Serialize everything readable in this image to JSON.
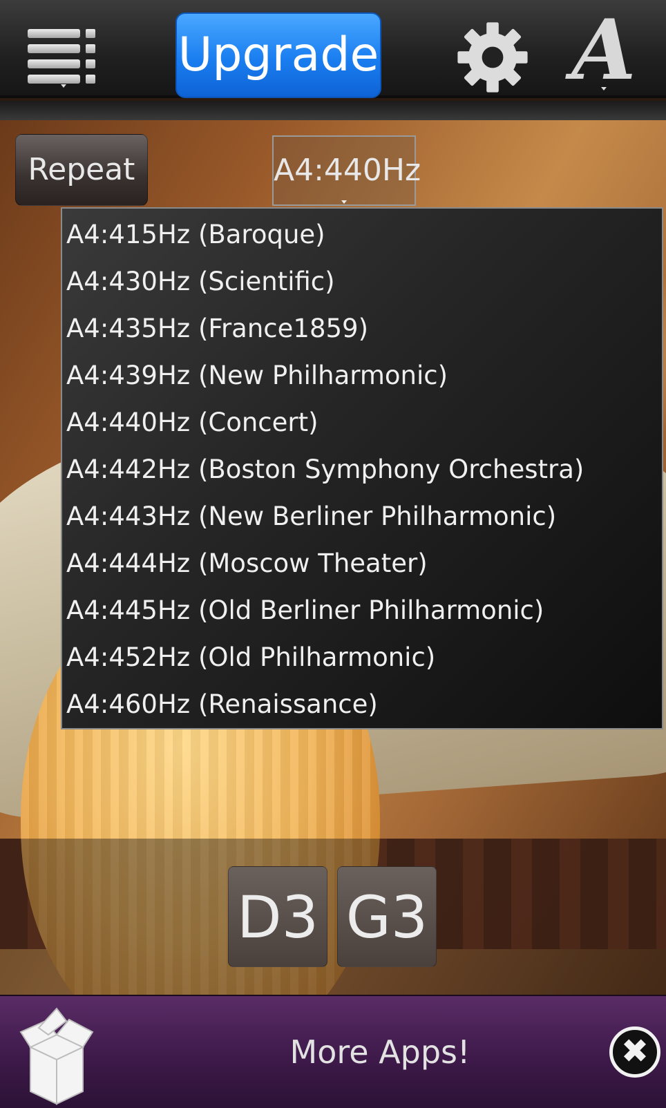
{
  "toolbar": {
    "menu_icon": "list-menu-icon",
    "upgrade_label": "Upgrade",
    "settings_icon": "gear-icon",
    "font_icon_glyph": "A"
  },
  "controls": {
    "repeat_label": "Repeat",
    "pitch_selected": "A4:440Hz"
  },
  "pitch_options": [
    "A4:415Hz (Baroque)",
    "A4:430Hz (Scientific)",
    "A4:435Hz (France1859)",
    "A4:439Hz (New Philharmonic)",
    "A4:440Hz (Concert)",
    "A4:442Hz (Boston Symphony Orchestra)",
    "A4:443Hz (New Berliner Philharmonic)",
    "A4:444Hz (Moscow Theater)",
    "A4:445Hz (Old Berliner Philharmonic)",
    "A4:452Hz (Old Philharmonic)",
    "A4:460Hz (Renaissance)"
  ],
  "strings": [
    "D3",
    "G3"
  ],
  "footer": {
    "more_apps_label": "More Apps!",
    "close_glyph": "✖"
  },
  "colors": {
    "accent": "#1a7ef0",
    "footer": "#3e1a4a"
  }
}
